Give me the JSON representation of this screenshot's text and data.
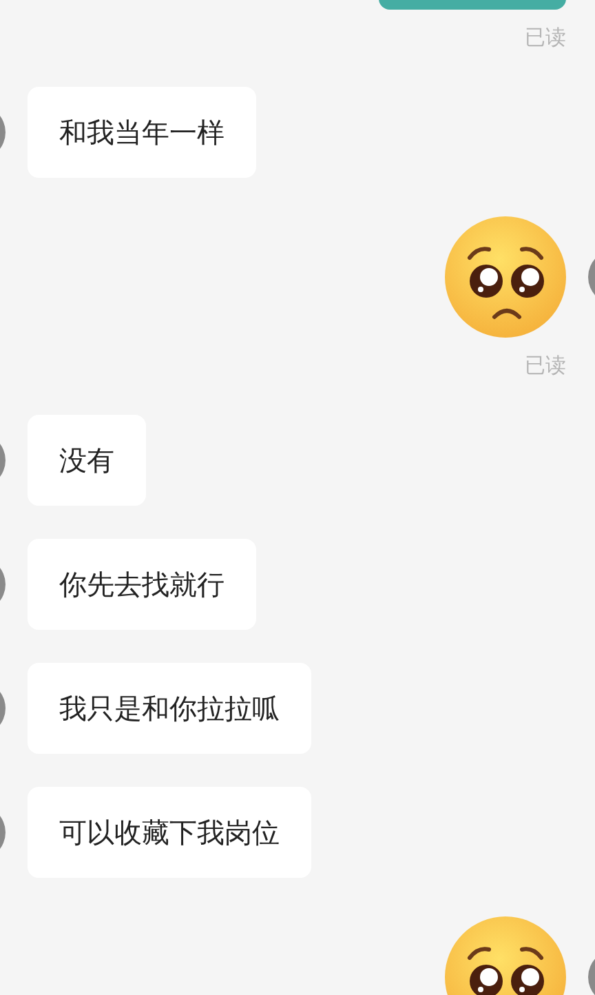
{
  "messages": [
    {
      "kind": "sent-bubble"
    },
    {
      "kind": "read-receipt",
      "text": "已读"
    },
    {
      "kind": "received-text",
      "text": "和我当年一样"
    },
    {
      "kind": "sent-emoji"
    },
    {
      "kind": "read-receipt",
      "text": "已读"
    },
    {
      "kind": "received-text",
      "text": "没有"
    },
    {
      "kind": "received-text",
      "text": "你先去找就行"
    },
    {
      "kind": "received-text",
      "text": "我只是和你拉拉呱"
    },
    {
      "kind": "received-text",
      "text": "可以收藏下我岗位"
    },
    {
      "kind": "sent-emoji"
    }
  ]
}
